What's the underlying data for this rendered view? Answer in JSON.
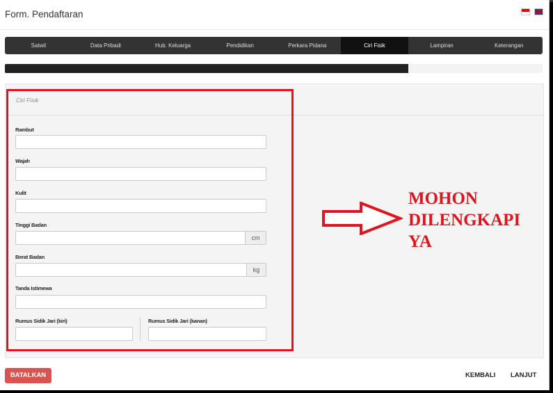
{
  "modal": {
    "title": "Form. Pendaftaran"
  },
  "tabs": [
    {
      "label": "Satwil"
    },
    {
      "label": "Data Pribadi"
    },
    {
      "label": "Hub. Keluarga"
    },
    {
      "label": "Pendidikan"
    },
    {
      "label": "Perkara Pidana"
    },
    {
      "label": "Ciri Fisik",
      "active": true
    },
    {
      "label": "Lampiran"
    },
    {
      "label": "Keterangan"
    }
  ],
  "progress": {
    "fraction": 0.75
  },
  "section": {
    "legend": "Ciri Fisik",
    "fields": {
      "rambut": {
        "label": "Rambut",
        "value": ""
      },
      "wajah": {
        "label": "Wajah",
        "value": ""
      },
      "kulit": {
        "label": "Kulit",
        "value": ""
      },
      "tinggi": {
        "label": "Tinggi Badan",
        "value": "",
        "unit": "cm"
      },
      "berat": {
        "label": "Berat Badan",
        "value": "",
        "unit": "kg"
      },
      "tanda": {
        "label": "Tanda Istimewa",
        "value": ""
      },
      "sidik_kiri": {
        "label": "Rumus Sidik Jari (kiri)",
        "value": ""
      },
      "sidik_kanan": {
        "label": "Rumus Sidik Jari (kanan)",
        "value": ""
      }
    }
  },
  "annotation": {
    "text": "MOHON\nDILENGKAPI\nYA",
    "color": "#e0141e"
  },
  "footer": {
    "cancel": "BATALKAN",
    "back": "KEMBALI",
    "next": "LANJUT"
  },
  "colors": {
    "tabbar": "#333333",
    "accent_red": "#d9534f"
  }
}
